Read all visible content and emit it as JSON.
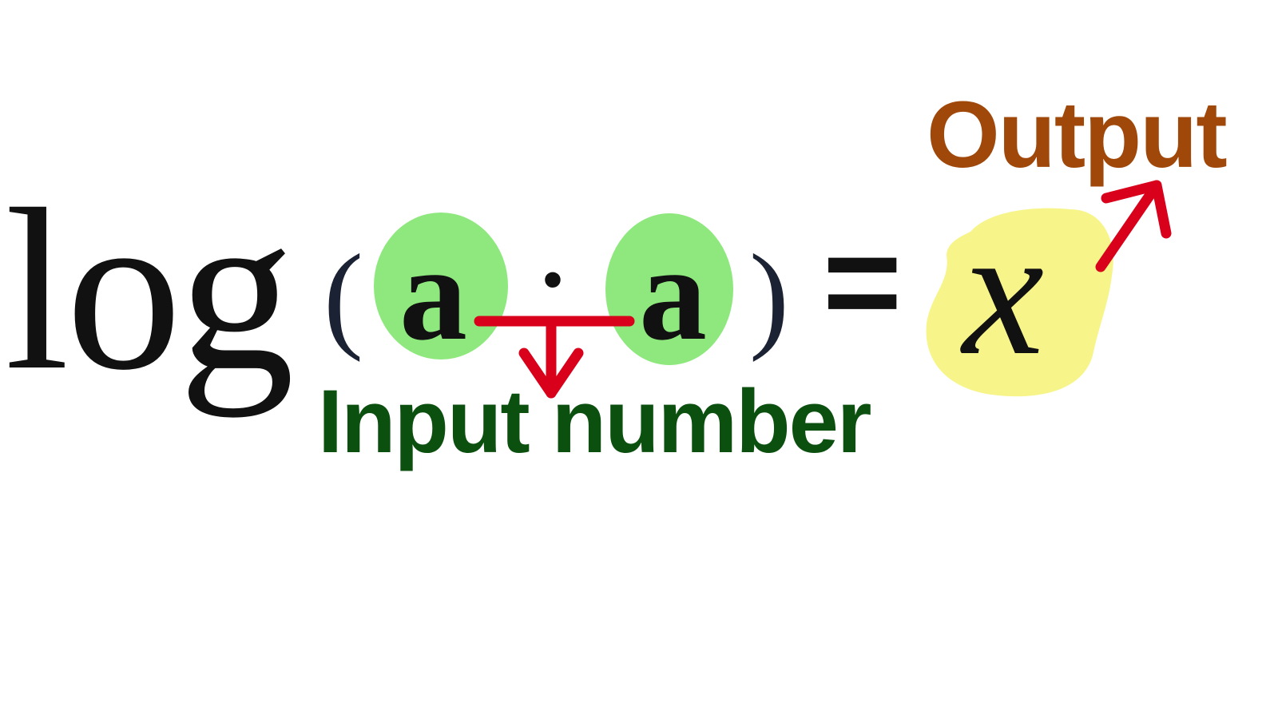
{
  "equation": {
    "func": "log",
    "open_paren": "(",
    "operand_left": "a",
    "operator": "·",
    "operand_right": "a",
    "close_paren": ")",
    "equals": "=",
    "result": "x"
  },
  "labels": {
    "output": "Output",
    "input": "Input number"
  },
  "colors": {
    "input_highlight": "#8ee87e",
    "output_highlight": "#f7f58a",
    "arrow": "#d9001b",
    "output_label": "#a0480a",
    "input_label": "#0c5010"
  }
}
